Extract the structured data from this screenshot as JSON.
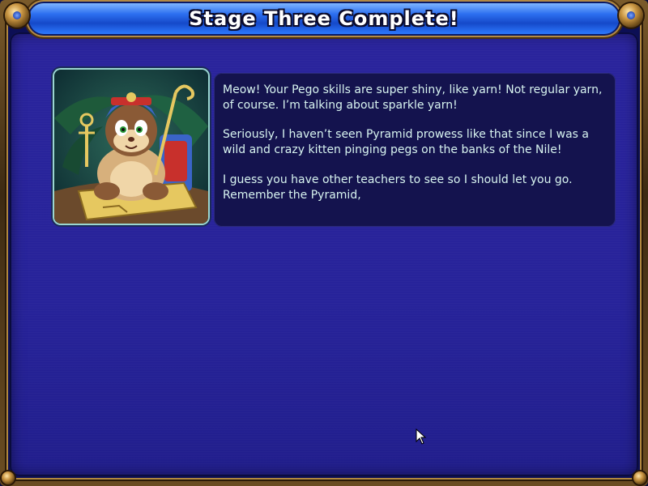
{
  "dialog": {
    "title": "Stage Three Complete!",
    "paragraphs": [
      "Meow!  Your Pego skills are super shiny, like yarn!  Not regular yarn, of course.  I’m talking about sparkle yarn!",
      "Seriously, I haven’t seen Pyramid prowess like that since I was a wild and crazy kitten pinging pegs on the banks of the Nile!",
      "I guess you have other teachers to see so I should let you go.  Remember the Pyramid,"
    ]
  },
  "portrait": {
    "character": "pharaoh-cat"
  },
  "colors": {
    "title_bar": "#2c6ff0",
    "panel": "#27239a",
    "text_box": "#14134e",
    "text": "#d8f4f0",
    "frame": "#b0873f"
  }
}
